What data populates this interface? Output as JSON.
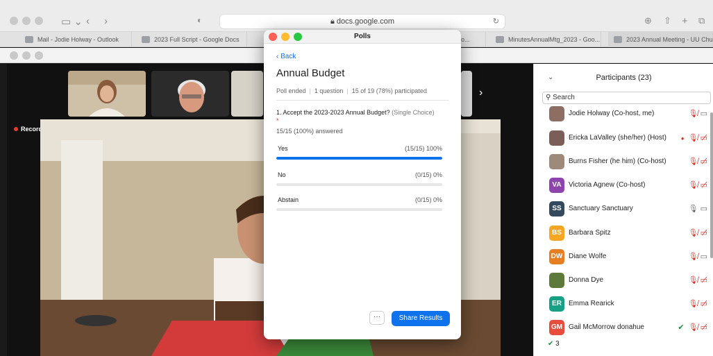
{
  "browser": {
    "url": "docs.google.com",
    "tabs": [
      {
        "label": "Mail - Jodie Holway - Outlook"
      },
      {
        "label": "2023 Full Script - Google Docs"
      },
      {
        "label": "o..."
      },
      {
        "label": "MinutesAnnualMtg_2023 - Goo..."
      },
      {
        "label": "2023 Annual Meeting - UU Chu..."
      }
    ]
  },
  "meeting": {
    "recording_label": "Recording"
  },
  "polls_window": {
    "window_title": "Polls",
    "back_label": "Back",
    "poll_title": "Annual Budget",
    "meta": {
      "status": "Poll ended",
      "questions": "1 question",
      "participation": "15 of 19 (78%) participated"
    },
    "question": {
      "text": "1. Accept the 2023-2023 Annual Budget?",
      "type": "(Single Choice)",
      "required_mark": "*",
      "answered": "15/15 (100%) answered"
    },
    "options": [
      {
        "label": "Yes",
        "result": "(15/15) 100%",
        "fraction": 1.0
      },
      {
        "label": "No",
        "result": "(0/15) 0%",
        "fraction": 0
      },
      {
        "label": "Abstain",
        "result": "(0/15) 0%",
        "fraction": 0
      }
    ],
    "more_label": "···",
    "share_label": "Share Results"
  },
  "participants": {
    "header": "Participants (23)",
    "search_placeholder": "Search",
    "list": [
      {
        "name": "Jodie Holway (Co-host, me)",
        "initials": "",
        "color": "#8d6e63"
      },
      {
        "name": "Ericka LaValley (she/her) (Host)",
        "initials": "",
        "color": "#7b5e57"
      },
      {
        "name": "Burns Fisher (he him) (Co-host)",
        "initials": "",
        "color": "#9e8a7a"
      },
      {
        "name": "Victoria Agnew (Co-host)",
        "initials": "VA",
        "color": "#8e44ad"
      },
      {
        "name": "Sanctuary Sanctuary",
        "initials": "SS",
        "color": "#34495e"
      },
      {
        "name": "Barbara Spitz",
        "initials": "BS",
        "color": "#f5a623"
      },
      {
        "name": "Diane Wolfe",
        "initials": "DW",
        "color": "#e67e22"
      },
      {
        "name": "Donna Dye",
        "initials": "",
        "color": "#5d7a3a"
      },
      {
        "name": "Emma Rearick",
        "initials": "ER",
        "color": "#16a085"
      },
      {
        "name": "Gail McMorrow donahue",
        "initials": "GM",
        "color": "#e74c3c"
      }
    ],
    "footer_count": "3"
  }
}
